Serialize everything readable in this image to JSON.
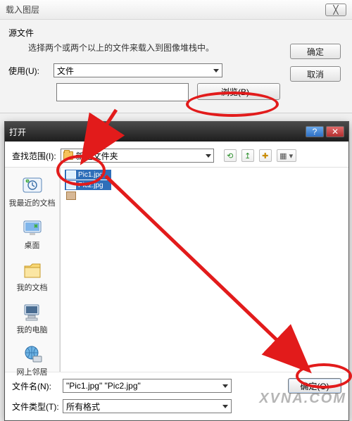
{
  "top_dialog": {
    "title": "载入图层",
    "close_glyph": "╳",
    "source_label": "源文件",
    "source_desc": "选择两个或两个以上的文件来载入到图像堆栈中。",
    "ok_label": "确定",
    "cancel_label": "取消",
    "use_label": "使用(U):",
    "use_value": "文件",
    "browse_label": "浏览(B)..."
  },
  "open_dialog": {
    "title": "打开",
    "help_glyph": "?",
    "close_glyph": "✕",
    "scope_label": "查找范围(I):",
    "scope_value": "新建文件夹",
    "toolbar": {
      "back": "⟲",
      "up": "↥",
      "new": "✚",
      "view": "▦ ▾"
    },
    "places": [
      {
        "label": "我最近的文档"
      },
      {
        "label": "桌面"
      },
      {
        "label": "我的文档"
      },
      {
        "label": "我的电脑"
      },
      {
        "label": "网上邻居"
      }
    ],
    "selected_files": [
      "Pic1.jpg",
      "Pic2.jpg"
    ],
    "other_file_partial": "",
    "filename_label": "文件名(N):",
    "filename_value": "\"Pic1.jpg\" \"Pic2.jpg\"",
    "filetype_label": "文件类型(T):",
    "filetype_value": "所有格式",
    "open_btn": "确定(O)"
  },
  "watermark": "XVNA.COM"
}
